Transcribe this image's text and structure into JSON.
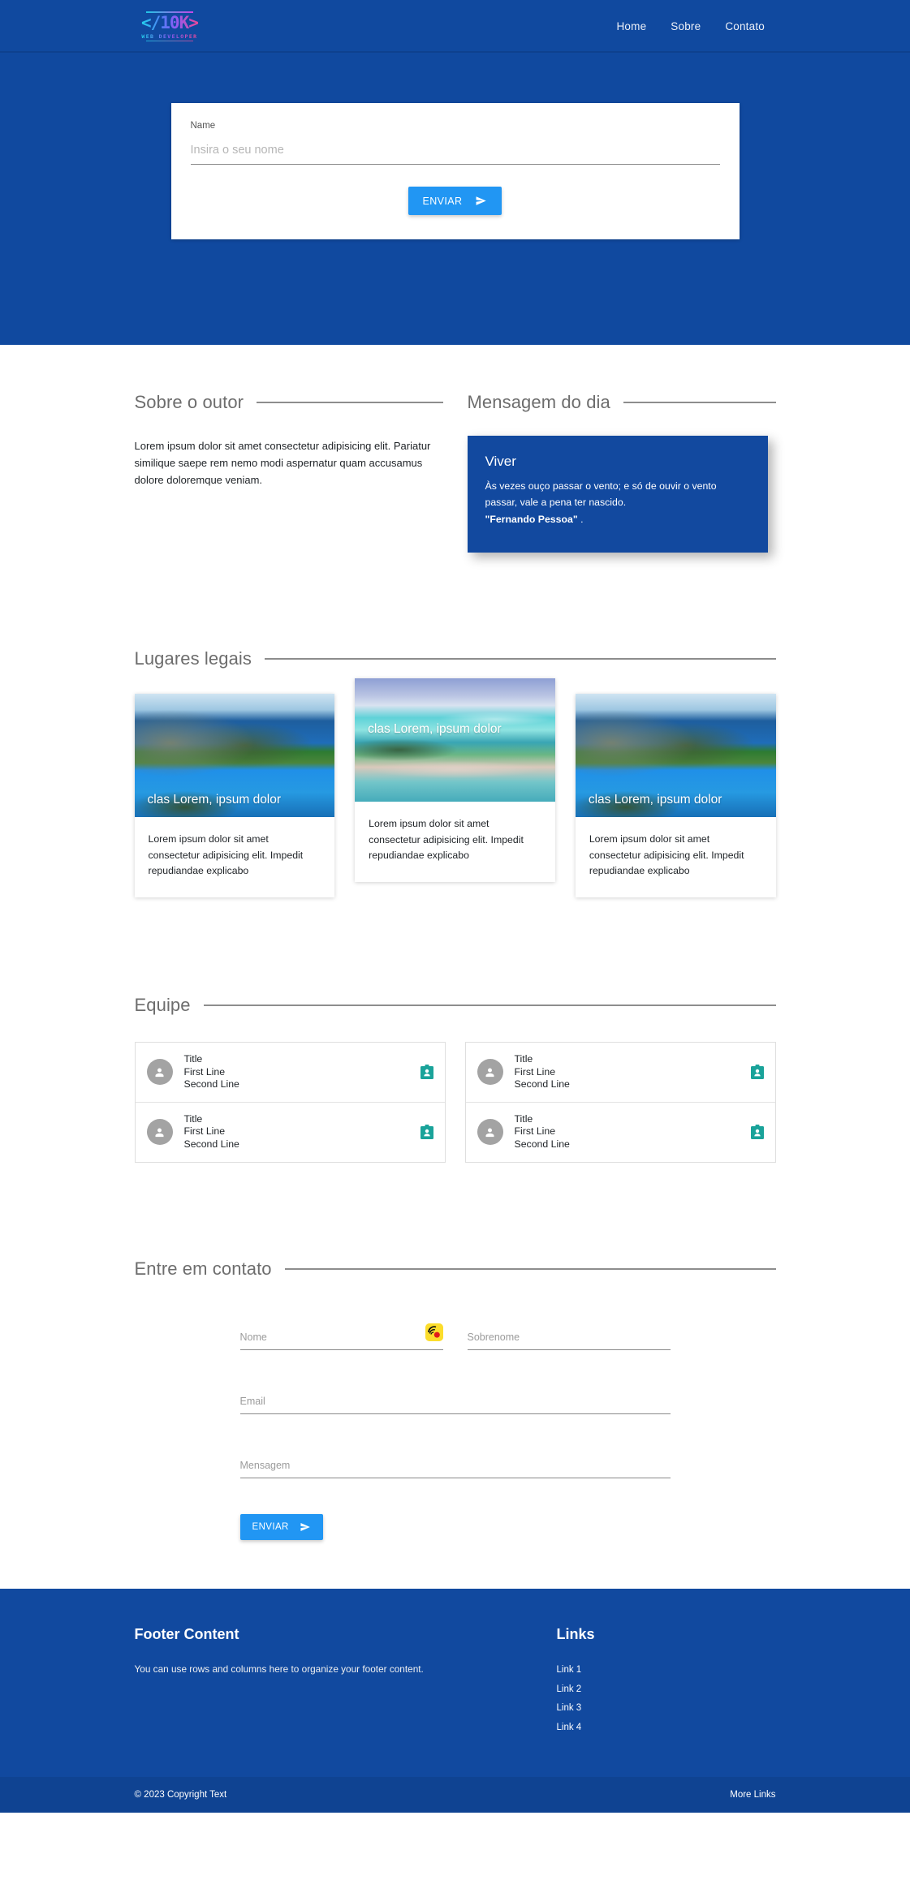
{
  "navbar": {
    "brand": {
      "logo_text": "</10K>",
      "tagline": "WEB DEVELOPER"
    },
    "links": [
      {
        "label": "Home"
      },
      {
        "label": "Sobre"
      },
      {
        "label": "Contato"
      }
    ]
  },
  "hero": {
    "form": {
      "label": "Name",
      "placeholder": "Insira o seu nome",
      "value": "",
      "submit_label": "ENVIAR"
    }
  },
  "about": {
    "heading": "Sobre o outor",
    "body": "Lorem ipsum dolor sit amet consectetur adipisicing elit. Pariatur similique saepe rem nemo modi aspernatur quam accusamus dolore doloremque veniam."
  },
  "message": {
    "heading": "Mensagem do dia",
    "card": {
      "title": "Viver",
      "text": "Às vezes ouço passar o vento; e só de ouvir o vento passar, vale a pena ter nascido.",
      "author": "\"Fernando Pessoa\"",
      "author_suffix": " ."
    }
  },
  "places": {
    "heading": "Lugares legais",
    "cards": [
      {
        "overlay_title": "clas Lorem, ipsum dolor",
        "body": "Lorem ipsum dolor sit amet consectetur adipisicing elit. Impedit repudiandae explicabo",
        "image": "beach-cliff-photo"
      },
      {
        "overlay_title": "clas Lorem, ipsum dolor",
        "body": "Lorem ipsum dolor sit amet consectetur adipisicing elit. Impedit repudiandae explicabo",
        "image": "tropical-lagoon-photo"
      },
      {
        "overlay_title": "clas Lorem, ipsum dolor",
        "body": "Lorem ipsum dolor sit amet consectetur adipisicing elit. Impedit repudiandae explicabo",
        "image": "beach-cliff-photo"
      }
    ]
  },
  "team": {
    "heading": "Equipe",
    "columns": [
      {
        "items": [
          {
            "title": "Title",
            "line1": "First Line",
            "line2": "Second Line"
          },
          {
            "title": "Title",
            "line1": "First Line",
            "line2": "Second Line"
          }
        ]
      },
      {
        "items": [
          {
            "title": "Title",
            "line1": "First Line",
            "line2": "Second Line"
          },
          {
            "title": "Title",
            "line1": "First Line",
            "line2": "Second Line"
          }
        ]
      }
    ]
  },
  "contact": {
    "heading": "Entre em contato",
    "fields": {
      "first_name_placeholder": "Nome",
      "last_name_placeholder": "Sobrenome",
      "email_placeholder": "Email",
      "message_placeholder": "Mensagem",
      "first_name_value": "",
      "last_name_value": "",
      "email_value": "",
      "message_value": ""
    },
    "submit_label": "ENVIAR"
  },
  "footer": {
    "content_heading": "Footer Content",
    "content_text": "You can use rows and columns here to organize your footer content.",
    "links_heading": "Links",
    "links": [
      {
        "label": "Link 1"
      },
      {
        "label": "Link 2"
      },
      {
        "label": "Link 3"
      },
      {
        "label": "Link 4"
      }
    ],
    "copyright": "© 2023 Copyright Text",
    "more_links": "More Links"
  },
  "colors": {
    "brand_blue": "#10499f",
    "accent_blue": "#2196f3",
    "teal_badge": "#1aa39a",
    "rule_gray": "#8d8d8d"
  }
}
